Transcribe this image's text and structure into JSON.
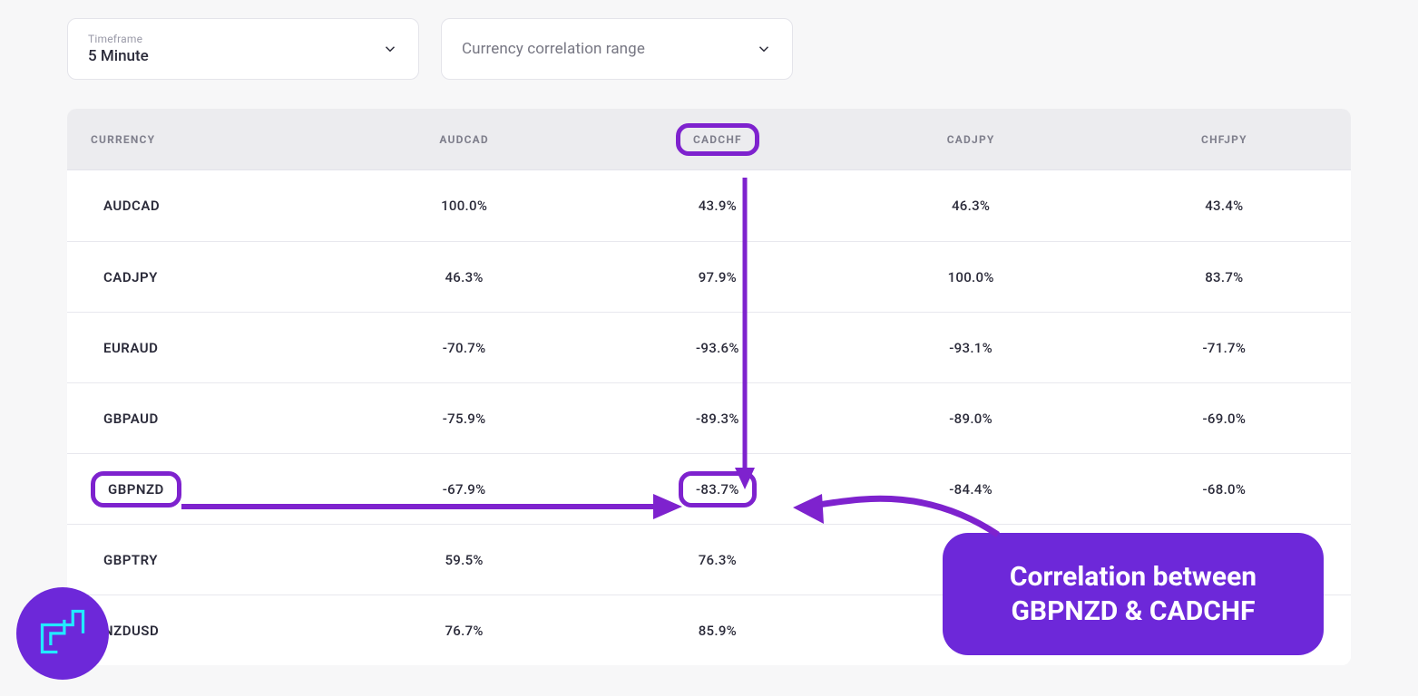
{
  "controls": {
    "timeframe": {
      "label": "Timeframe",
      "value": "5 Minute"
    },
    "correlation_range": {
      "placeholder": "Currency correlation range"
    }
  },
  "table": {
    "header": {
      "currency": "CURRENCY",
      "cols": [
        "AUDCAD",
        "CADCHF",
        "CADJPY",
        "CHFJPY"
      ]
    },
    "rows": [
      {
        "currency": "AUDCAD",
        "values": [
          "100.0%",
          "43.9%",
          "46.3%",
          "43.4%"
        ]
      },
      {
        "currency": "CADJPY",
        "values": [
          "46.3%",
          "97.9%",
          "100.0%",
          "83.7%"
        ]
      },
      {
        "currency": "EURAUD",
        "values": [
          "-70.7%",
          "-93.6%",
          "-93.1%",
          "-71.7%"
        ]
      },
      {
        "currency": "GBPAUD",
        "values": [
          "-75.9%",
          "-89.3%",
          "-89.0%",
          "-69.0%"
        ]
      },
      {
        "currency": "GBPNZD",
        "values": [
          "-67.9%",
          "-83.7%",
          "-84.4%",
          "-68.0%"
        ]
      },
      {
        "currency": "GBPTRY",
        "values": [
          "59.5%",
          "76.3%",
          "",
          ""
        ]
      },
      {
        "currency": "NZDUSD",
        "values": [
          "76.7%",
          "85.9%",
          "",
          ""
        ]
      }
    ]
  },
  "annotations": {
    "highlight_column": "CADCHF",
    "highlight_row": "GBPNZD",
    "callout_line1": "Correlation between",
    "callout_line2": "GBPNZD & CADCHF"
  },
  "colors": {
    "accent": "#6d28d9",
    "highlight_border": "#7e22ce",
    "avatar_glyph": "#22eaff"
  }
}
